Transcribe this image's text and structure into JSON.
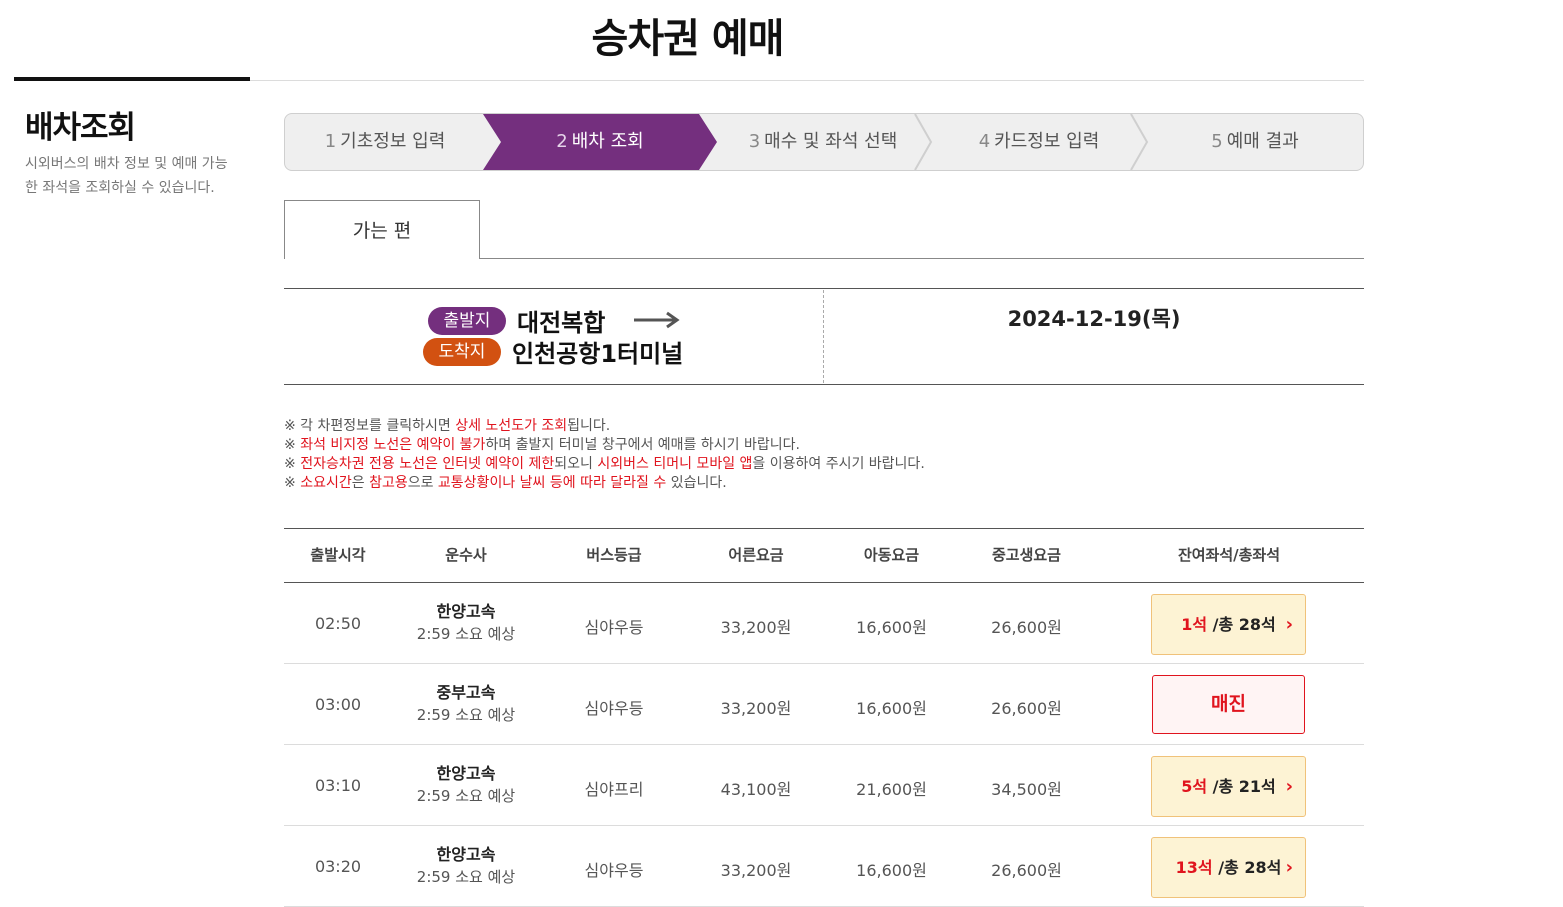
{
  "page_title": "승차권 예매",
  "sidebar": {
    "title": "배차조회",
    "description": "시외버스의 배차 정보 및 예매 가능한 좌석을 조회하실 수 있습니다."
  },
  "steps": [
    {
      "num": "1",
      "label": "기초정보 입력"
    },
    {
      "num": "2",
      "label": "배차 조회"
    },
    {
      "num": "3",
      "label": "매수 및 좌석 선택"
    },
    {
      "num": "4",
      "label": "카드정보 입력"
    },
    {
      "num": "5",
      "label": "예매 결과"
    }
  ],
  "active_step": 2,
  "tab": {
    "label": "가는 편"
  },
  "route": {
    "departure_badge": "출발지",
    "departure": "대전복합",
    "arrival_badge": "도착지",
    "arrival": "인천공항1터미널",
    "date": "2024-12-19(목)"
  },
  "notices": [
    [
      {
        "t": "※ 각 차편정보를 클릭하시면 "
      },
      {
        "t": "상세 노선도가 조회",
        "red": true
      },
      {
        "t": "됩니다."
      }
    ],
    [
      {
        "t": "※ "
      },
      {
        "t": "좌석 비지정 노선은 예약이 불가",
        "red": true
      },
      {
        "t": "하며 출발지 터미널 창구에서 예매를 하시기 바랍니다."
      }
    ],
    [
      {
        "t": "※ "
      },
      {
        "t": "전자승차권 전용 노선은 인터넷 예약이 제한",
        "red": true
      },
      {
        "t": "되오니 "
      },
      {
        "t": "시외버스 티머니 모바일 앱",
        "red": true
      },
      {
        "t": "을 이용하여 주시기 바랍니다."
      }
    ],
    [
      {
        "t": "※ "
      },
      {
        "t": "소요시간",
        "red": true
      },
      {
        "t": "은 "
      },
      {
        "t": "참고용",
        "red": true
      },
      {
        "t": "으로 "
      },
      {
        "t": "교통상황이나 날씨 등에 따라 달라질 수",
        "red": true
      },
      {
        "t": " 있습니다."
      }
    ]
  ],
  "table": {
    "headers": [
      "출발시각",
      "운수사",
      "버스등급",
      "어른요금",
      "아동요금",
      "중고생요금",
      "잔여좌석/총좌석"
    ],
    "rows": [
      {
        "time": "02:50",
        "company": "한양고속",
        "duration": "2:59 소요 예상",
        "grade": "심야우등",
        "adult": "33,200원",
        "child": "16,600원",
        "student": "26,600원",
        "remaining": "1석",
        "total": " /총 28석",
        "sold_out": false
      },
      {
        "time": "03:00",
        "company": "중부고속",
        "duration": "2:59 소요 예상",
        "grade": "심야우등",
        "adult": "33,200원",
        "child": "16,600원",
        "student": "26,600원",
        "sold_out": true,
        "sold_out_label": "매진"
      },
      {
        "time": "03:10",
        "company": "한양고속",
        "duration": "2:59 소요 예상",
        "grade": "심야프리",
        "adult": "43,100원",
        "child": "21,600원",
        "student": "34,500원",
        "remaining": "5석",
        "total": " /총 21석",
        "sold_out": false
      },
      {
        "time": "03:20",
        "company": "한양고속",
        "duration": "2:59 소요 예상",
        "grade": "심야우등",
        "adult": "33,200원",
        "child": "16,600원",
        "student": "26,600원",
        "remaining": "13석",
        "total": " /총 28석",
        "sold_out": false
      }
    ]
  },
  "colors": {
    "accent": "#742f7e",
    "arrival": "#d25111",
    "highlight": "#e0141e",
    "seat_bg": "#fdf3d4"
  }
}
